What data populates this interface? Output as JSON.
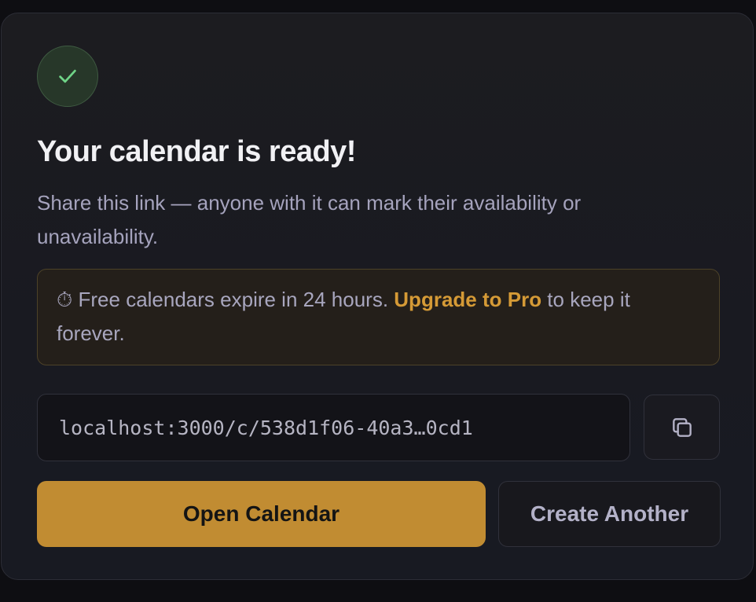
{
  "card": {
    "title": "Your calendar is ready!",
    "subtitle": "Share this link — anyone with it can mark their availability or unavailability."
  },
  "notice": {
    "icon": "⏱",
    "text_before": " Free calendars expire in 24 hours. ",
    "upgrade_label": "Upgrade to Pro",
    "text_after": " to keep it forever."
  },
  "share": {
    "link_value": "localhost:3000/c/538d1f06-40a3…0cd1",
    "copy_icon": "copy-icon"
  },
  "actions": {
    "open_label": "Open Calendar",
    "create_label": "Create Another"
  },
  "colors": {
    "accent": "#c18c32",
    "success": "#6fd487",
    "link_accent": "#d59a36"
  }
}
